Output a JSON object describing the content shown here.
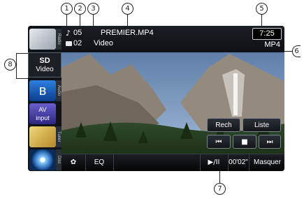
{
  "callouts": [
    "1",
    "2",
    "3",
    "4",
    "5",
    "6",
    "7",
    "8"
  ],
  "header": {
    "track_icon": "music-note-icon",
    "track_number": "05",
    "file_name": "PREMIER.MP4",
    "folder_icon": "folder-icon",
    "folder_number": "02",
    "media_type": "Video",
    "clock": "7:25",
    "format": "MP4"
  },
  "sidebar": {
    "active_source_line1": "SD",
    "active_source_line2": "Video",
    "tabs": [
      "Radio",
      "Audio",
      "Tuner",
      "Disc"
    ],
    "sources": [
      "map-source-icon",
      "sd-video-source-icon",
      "bluetooth-source-icon",
      "av-input-source-icon",
      "tuner-source-icon",
      "disc-source-icon"
    ]
  },
  "controls": {
    "search_label": "Rech",
    "list_label": "Liste",
    "prev_glyph": "⏮",
    "stop_glyph": "■",
    "next_glyph": "⏭"
  },
  "bottom": {
    "settings_glyph": "✿",
    "eq_label": "EQ",
    "play_pause_label": "▶/II",
    "elapsed_time": "00'02\"",
    "hide_label": "Masquer"
  },
  "colors": {
    "device_bg": "#0b0d10",
    "button_border": "#7b828c",
    "text": "#ffffff"
  }
}
